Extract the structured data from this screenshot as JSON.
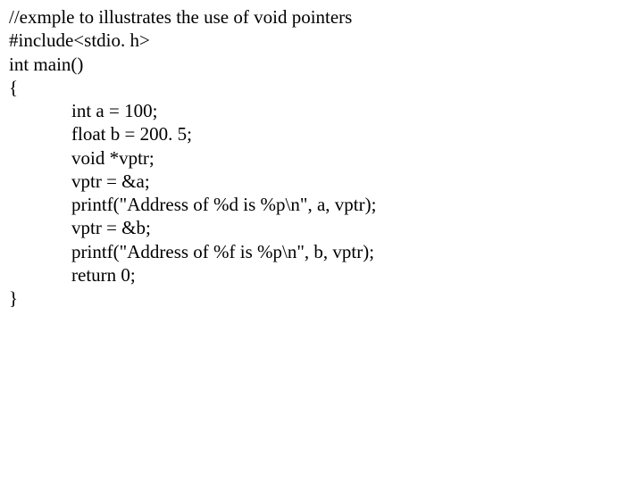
{
  "code": {
    "l1": "//exmple to illustrates the use of void pointers",
    "l2": "#include<stdio. h>",
    "l3": "int main()",
    "l4": "{",
    "l5": "int a = 100;",
    "l6": "float b = 200. 5;",
    "blank": "",
    "l7": "void *vptr;",
    "l8": "vptr = &a;",
    "l9": "printf(\"Address of %d is %p\\n\", a, vptr);",
    "l10": "vptr = &b;",
    "l11": "printf(\"Address of %f is %p\\n\", b, vptr);",
    "l12": "return 0;",
    "l13": "}"
  }
}
